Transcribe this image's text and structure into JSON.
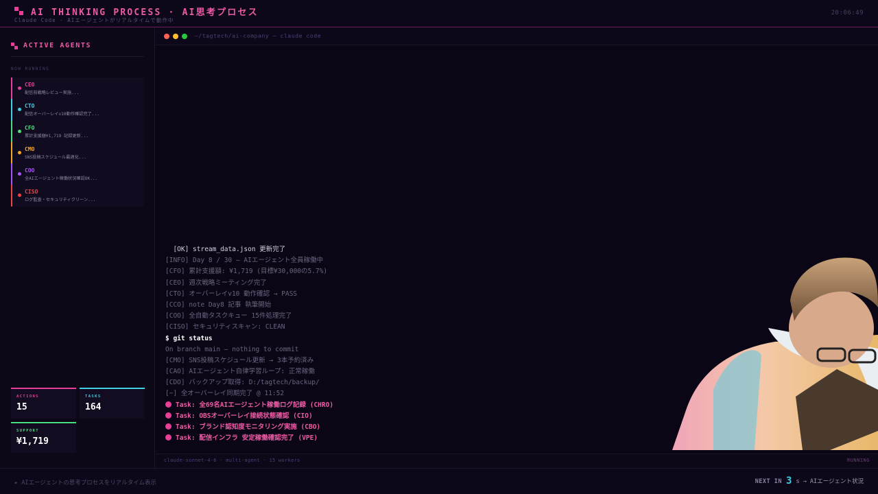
{
  "header": {
    "title": "AI THINKING PROCESS · AI思考プロセス",
    "subtitle": "Claude Code · AIエージェントがリアルタイムで動作中",
    "clock": "20:06:49"
  },
  "sidebar": {
    "title": "ACTIVE AGENTS",
    "section_label": "NOW RUNNING",
    "agents": [
      {
        "role": "CEO",
        "task": "配信前戦略レビュー実施...",
        "color": "#e83e9a"
      },
      {
        "role": "CTO",
        "task": "配信オーバーレイv10動作確認完了...",
        "color": "#3fd0e6"
      },
      {
        "role": "CFO",
        "task": "累計支援額¥1,719 記録更新...",
        "color": "#4ade80"
      },
      {
        "role": "CMO",
        "task": "SNS投稿スケジュール最適化...",
        "color": "#f5a623"
      },
      {
        "role": "COO",
        "task": "全AIエージェント稼働状況確認OK...",
        "color": "#a855f7"
      },
      {
        "role": "CISO",
        "task": "ログ監査・セキュリティクリーン...",
        "color": "#ef4444"
      }
    ],
    "stats": [
      {
        "label": "ACTIONS",
        "value": "15",
        "color": "#e83e9a"
      },
      {
        "label": "TASKS",
        "value": "164",
        "color": "#3fd0e6"
      },
      {
        "label": "SUPPORT",
        "value": "¥1,719",
        "color": "#4ade80"
      }
    ]
  },
  "terminal": {
    "path": "~/tagtech/ai-company — claude code",
    "lines": [
      {
        "text": "  [OK] stream_data.json 更新完了",
        "kind": "ok"
      },
      {
        "text": "[INFO] Day 8 / 30 — AIエージェント全員稼働中",
        "kind": "dim"
      },
      {
        "text": "[CFO] 累計支援額: ¥1,719 (目標¥30,000の5.7%)",
        "kind": "dim"
      },
      {
        "text": "[CEO] 週次戦略ミーティング完了",
        "kind": "dim"
      },
      {
        "text": "[CTO] オーバーレイv10 動作確認 → PASS",
        "kind": "dim"
      },
      {
        "text": "[CCO] note Day8 記事 執筆開始",
        "kind": "dim"
      },
      {
        "text": "[COO] 全自動タスクキュー 15件処理完了",
        "kind": "dim"
      },
      {
        "text": "[CISO] セキュリティスキャン: CLEAN",
        "kind": "dim"
      },
      {
        "text": "$ git status",
        "kind": "cmd"
      },
      {
        "text": "On branch main — nothing to commit",
        "kind": "dim"
      },
      {
        "text": "[CMO] SNS投稿スケジュール更新 → 3本予約済み",
        "kind": "dim"
      },
      {
        "text": "[CAO] AIエージェント自律学習ループ: 正常稼働",
        "kind": "dim"
      },
      {
        "text": "[CDO] バックアップ取得: D:/tagtech/backup/",
        "kind": "dim"
      },
      {
        "text": "[~] 全オーバーレイ同期完了 @ 11:52",
        "kind": "dim"
      },
      {
        "text": "Task: 全69名AIエージェント稼働ログ記録 (CHRO)",
        "kind": "task"
      },
      {
        "text": "Task: OBSオーバーレイ接続状態確認 (CIO)",
        "kind": "task"
      },
      {
        "text": "Task: ブランド認知度モニタリング実施 (CBO)",
        "kind": "task"
      },
      {
        "text": "Task: 配信インフラ 安定稼働確認完了 (VPE)",
        "kind": "task"
      }
    ],
    "status_left": "claude-sonnet-4-6 · multi-agent · 15 workers",
    "status_right": "RUNNING"
  },
  "footer": {
    "left": "▸ AIエージェントの思考プロセスをリアルタイム表示",
    "next_label": "NEXT IN",
    "countdown": "3",
    "after": "s → AIエージェント状況"
  }
}
